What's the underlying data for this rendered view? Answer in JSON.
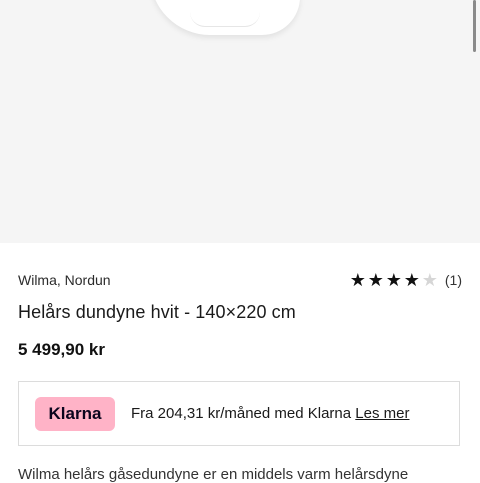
{
  "product": {
    "brand": "Wilma, Nordun",
    "title": "Helårs dundyne hvit - 140×220 cm",
    "price": "5 499,90 kr",
    "rating": {
      "value": 4,
      "max": 5,
      "count_text": "(1)"
    },
    "image_icon": "duvet-image"
  },
  "klarna": {
    "badge": "Klarna",
    "text": "Fra 204,31 kr/måned med Klarna",
    "link": "Les mer",
    "badge_color": "#ffb3c7"
  },
  "description": {
    "text": "Wilma helårs gåsedundyne er en middels varm helårsdyne"
  }
}
